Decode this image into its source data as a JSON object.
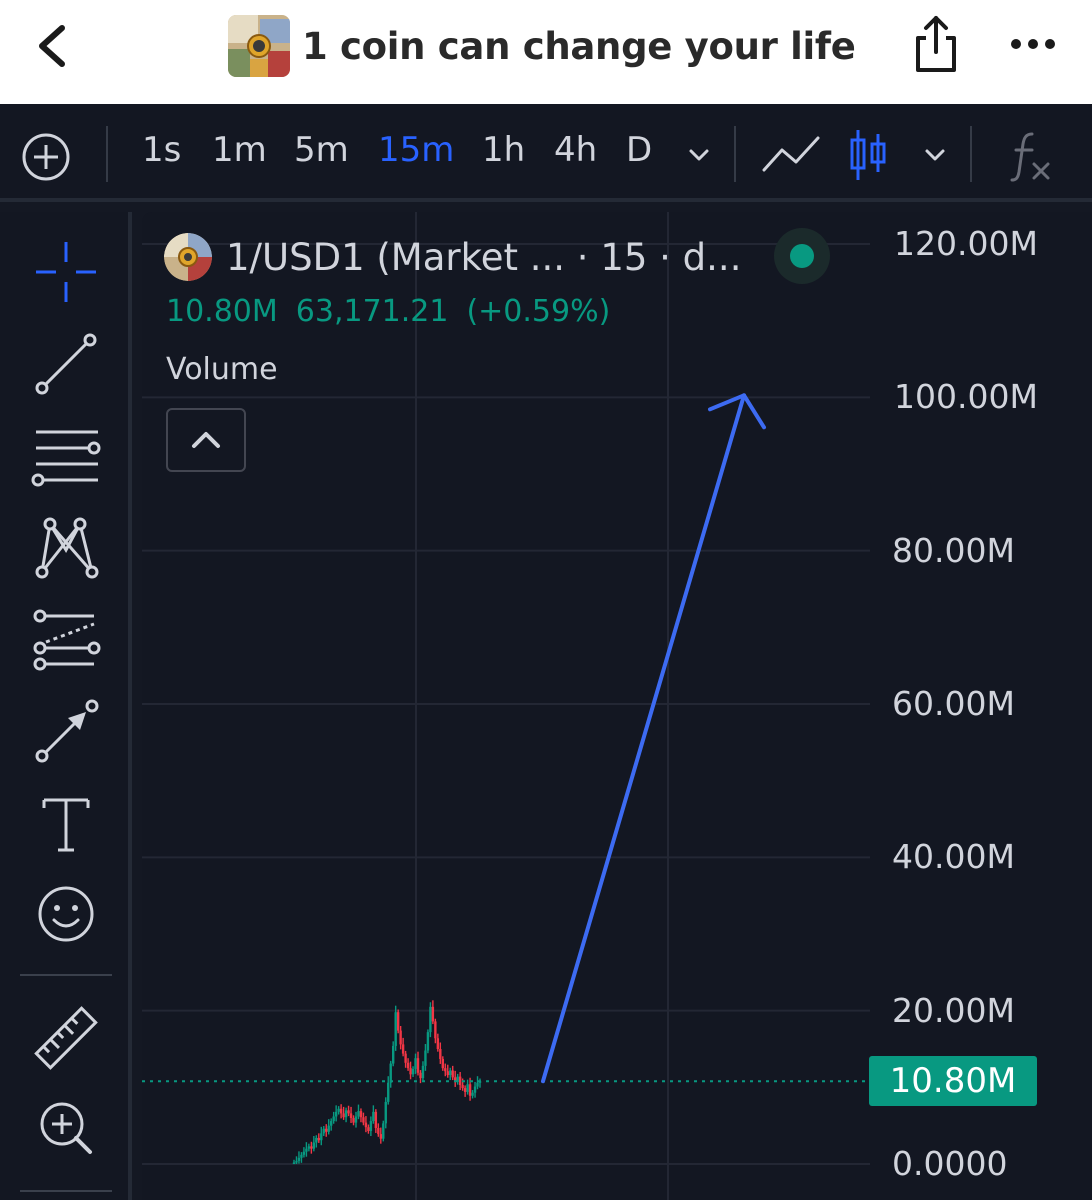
{
  "header": {
    "title": "1 coin can change your life",
    "back_icon": "chevron-left-icon",
    "share_icon": "share-icon",
    "more_icon": "more-dots-icon"
  },
  "toolbar": {
    "timeframes": [
      "1s",
      "1m",
      "5m",
      "15m",
      "1h",
      "4h",
      "D"
    ],
    "active_timeframe": "15m",
    "accent_color": "#2962ff"
  },
  "legend": {
    "title": "1/USD1 (Market ... · 15 · d...",
    "value": "10.80M",
    "volume_value": "63,171.21",
    "change": "(+0.59%)",
    "volume_label": "Volume",
    "up_color": "#089981",
    "down_color": "#f23645"
  },
  "price_axis": {
    "ticks": [
      "120.00M",
      "100.00M",
      "80.00M",
      "60.00M",
      "40.00M",
      "20.00M",
      "0.0000"
    ],
    "current_label": "10.80M"
  },
  "chart_data": {
    "type": "line",
    "title": "",
    "xlabel": "",
    "ylabel": "",
    "ylim": [
      0,
      120
    ],
    "y_ticks": [
      0,
      20,
      40,
      60,
      80,
      100,
      120
    ],
    "price_line": 10.8,
    "x": [
      0,
      1,
      2,
      3,
      4,
      5,
      6,
      7,
      8,
      9,
      10,
      11,
      12,
      13,
      14,
      15,
      16,
      17,
      18,
      19,
      20,
      21,
      22,
      23,
      24,
      25,
      26,
      27,
      28,
      29,
      30,
      31,
      32,
      33,
      34,
      35,
      36,
      37,
      38,
      39,
      40,
      41,
      42,
      43,
      44,
      45,
      46,
      47,
      48,
      49,
      50,
      51,
      52,
      53,
      54,
      55,
      56,
      57,
      58,
      59,
      60,
      61,
      62,
      63,
      64,
      65,
      66,
      67,
      68,
      69,
      70,
      71,
      72,
      73,
      74,
      75
    ],
    "series": [
      {
        "values": [
          0.2,
          0.4,
          0.8,
          1.2,
          1.6,
          2.0,
          2.3,
          2.0,
          2.8,
          3.4,
          3.1,
          4.0,
          4.6,
          4.2,
          5.0,
          5.6,
          6.2,
          6.8,
          7.2,
          6.6,
          6.1,
          7.0,
          6.6,
          6.0,
          5.4,
          6.2,
          6.9,
          6.1,
          5.4,
          4.8,
          4.3,
          5.6,
          6.8,
          4.7,
          3.9,
          3.3,
          5.3,
          8.1,
          10.6,
          13.1,
          15.4,
          19.8,
          17.4,
          15.6,
          14.4,
          13.2,
          12.5,
          11.7,
          12.4,
          13.8,
          11.9,
          11.2,
          12.8,
          14.8,
          17.2,
          20.5,
          18.6,
          16.4,
          15.0,
          13.7,
          12.5,
          12.1,
          11.6,
          12.2,
          11.3,
          10.7,
          11.4,
          10.3,
          9.9,
          9.4,
          10.4,
          8.9,
          9.3,
          10.1,
          10.6,
          10.8
        ],
        "color": "#089981"
      }
    ],
    "annotation": {
      "type": "arrow",
      "from": 10.8,
      "to": 100,
      "color": "#3d6bf2"
    }
  }
}
